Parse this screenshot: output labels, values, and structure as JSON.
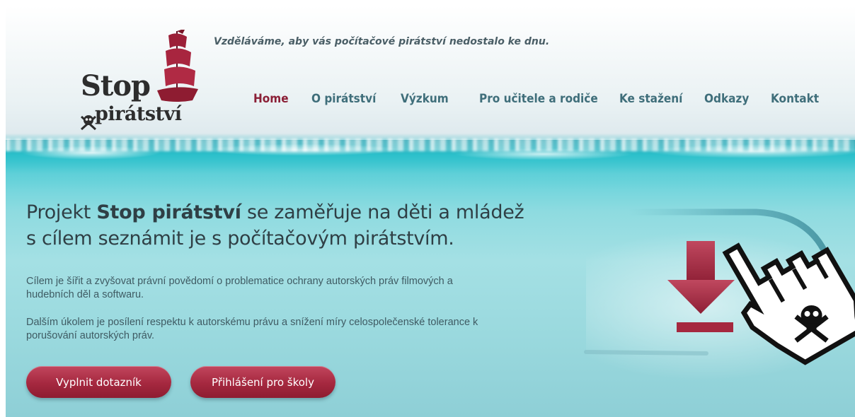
{
  "header": {
    "tagline": "Vzděláváme, aby vás počítačové pirátství nedostalo ke dnu.",
    "logo": {
      "line1": "Stop",
      "line2": "pirátství"
    }
  },
  "nav": {
    "items": [
      {
        "label": "Home",
        "active": true
      },
      {
        "label": "O pirátství",
        "active": false
      },
      {
        "label": "Výzkum",
        "active": false
      },
      {
        "label": "Pro učitele a rodiče",
        "active": false
      },
      {
        "label": "Ke stažení",
        "active": false
      },
      {
        "label": "Odkazy",
        "active": false
      },
      {
        "label": "Kontakt",
        "active": false
      }
    ]
  },
  "hero": {
    "headline_pre": "Projekt ",
    "headline_bold": "Stop pirátství",
    "headline_post": " se zaměřuje na děti a mládež",
    "headline_line2": "s cílem seznámit je s počítačovým pirátstvím.",
    "para1": "Cílem je šířit a zvyšovat právní povědomí o problematice ochrany autorských práv filmových a hudebních děl a softwaru.",
    "para2": "Dalším úkolem je posílení respektu k autorskému právu a snížení míry celospolečenské tolerance k porušování autorských práv.",
    "button1": "Vyplnit dotazník",
    "button2": "Přihlášení pro školy"
  },
  "colors": {
    "accent": "#a5283f",
    "nav": "#3f6e7a",
    "nav_active": "#8b2037",
    "text": "#2f3f45"
  },
  "icons": [
    "pirate-ship-icon",
    "skull-crossbones-icon",
    "download-arrow-icon",
    "hand-cursor-icon"
  ]
}
